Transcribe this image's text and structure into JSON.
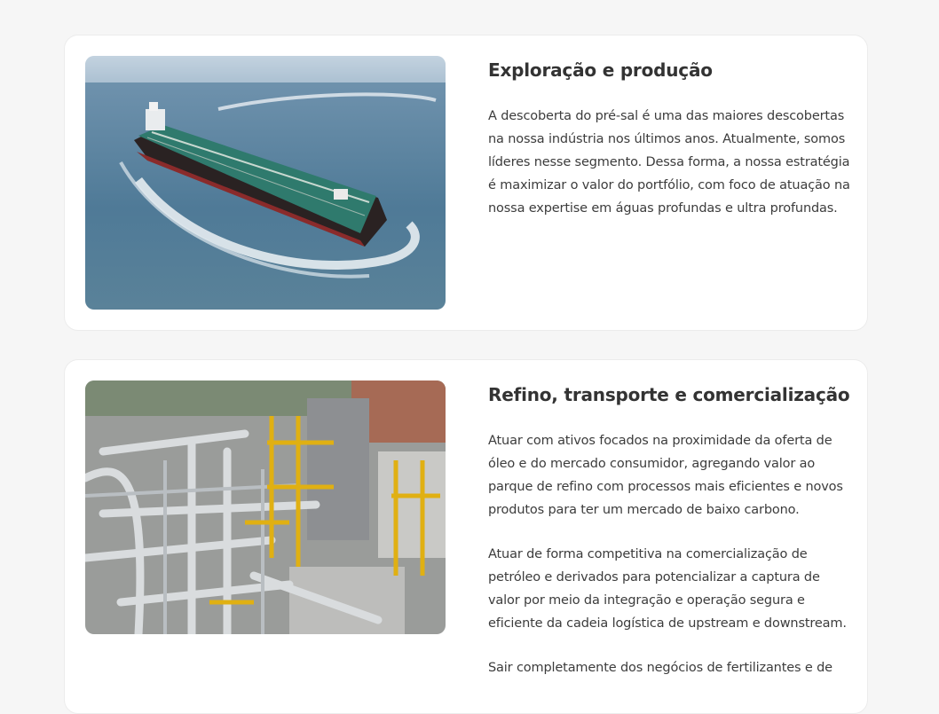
{
  "sections": [
    {
      "title": "Exploração e produção",
      "image_alt": "oil-tanker-ship-photo",
      "paragraphs": [
        "A descoberta do pré-sal é uma das maiores descobertas na nossa indústria nos últimos anos. Atualmente, somos líderes nesse segmento. Dessa forma, a nossa estratégia é maximizar o valor do portfólio, com foco de atuação na nossa expertise em águas profundas e ultra profundas."
      ]
    },
    {
      "title": "Refino, transporte e comercialização",
      "image_alt": "refinery-pipes-photo",
      "paragraphs": [
        "Atuar com ativos focados na proximidade da oferta de óleo e do mercado consumidor, agregando valor ao parque de refino com processos mais eficientes e novos produtos para ter um mercado de baixo carbono.",
        "Atuar de forma competitiva na comercialização de petróleo e derivados para potencializar a captura de valor por meio da integração e operação segura e eficiente da cadeia logística de upstream e downstream.",
        "Sair completamente dos negócios de fertilizantes e de"
      ]
    }
  ]
}
